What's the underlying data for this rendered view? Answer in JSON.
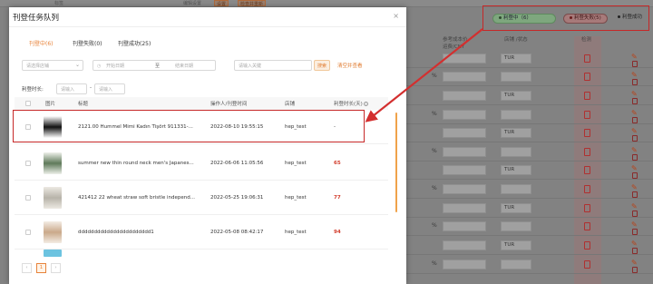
{
  "background": {
    "top_chips": [
      "标签",
      "编辑设置",
      "设置",
      "检查并重新"
    ],
    "columns": [
      "参考成本价\n运费/CNY",
      "店铺 /状态",
      "检测"
    ],
    "currency_label": "TUR",
    "percent": "%"
  },
  "status_filters": {
    "active": "利登中（6）",
    "failed": "利登失败(5)",
    "success": "利登成功"
  },
  "modal": {
    "title": "刊登任务队列",
    "close": "×",
    "tabs": [
      "刊登中(6)",
      "刊登失败(0)",
      "刊登成功(25)"
    ],
    "filters": {
      "shop_select": "请选择店铺",
      "start_date": "开始日期",
      "date_sep": "至",
      "end_date": "结束日期",
      "keyword": "请输入关键",
      "search_btn": "搜索",
      "clear_link": "清空并查看"
    },
    "duration": {
      "label": "利登时长:",
      "from": "请输入",
      "sep": "-",
      "to": "请输入"
    },
    "table": {
      "headers": {
        "image": "图片",
        "title": "标题",
        "operator": "操作人/刊登时间",
        "shop": "店铺",
        "duration": "利登时长(天)"
      },
      "rows": [
        {
          "title": "2121.00 Hummel Mimi Kadın Tişört 911331-...",
          "time": "2022-08-10 19:55:15",
          "shop": "hep_test",
          "duration": "-"
        },
        {
          "title": "summer new thin round neck men's Japanes...",
          "time": "2022-06-06 11:05:56",
          "shop": "hep_test",
          "duration": "65"
        },
        {
          "title": "421412 22 wheat straw soft bristle independ...",
          "time": "2022-05-25 19:06:31",
          "shop": "hep_test",
          "duration": "77"
        },
        {
          "title": "ddddddddddddddddddddddd1",
          "time": "2022-05-08 08:42:17",
          "shop": "hep_test",
          "duration": "94"
        }
      ]
    },
    "pager": {
      "prev": "‹",
      "page": "1",
      "next": "›"
    }
  },
  "colors": {
    "accent": "#e8833a",
    "highlight": "#c62828",
    "red_value": "#d23b2a"
  }
}
